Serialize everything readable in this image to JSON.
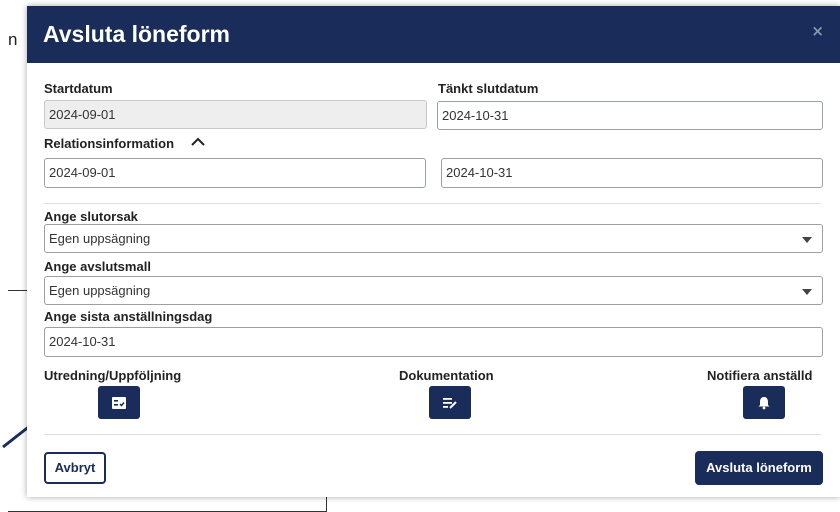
{
  "background": {
    "text_fragment": "n"
  },
  "modal": {
    "title": "Avsluta löneform",
    "close_symbol": "×",
    "start_date": {
      "label": "Startdatum",
      "value": "2024-09-01"
    },
    "planned_end_date": {
      "label": "Tänkt slutdatum",
      "value": "2024-10-31"
    },
    "relation_info": {
      "label": "Relationsinformation",
      "expanded": true,
      "start_value": "2024-09-01",
      "end_value": "2024-10-31"
    },
    "end_reason": {
      "label": "Ange slutorsak",
      "selected": "Egen uppsägning"
    },
    "end_template": {
      "label": "Ange avslutsmall",
      "selected": "Egen uppsägning"
    },
    "last_employment_day": {
      "label": "Ange sista anställningsdag",
      "value": "2024-10-31"
    },
    "actions": {
      "investigation": {
        "label": "Utredning/Uppföljning",
        "icon": "checklist-icon"
      },
      "documentation": {
        "label": "Dokumentation",
        "icon": "edit-note-icon"
      },
      "notify": {
        "label": "Notifiera anställd",
        "icon": "bell-icon"
      }
    },
    "cancel_label": "Avbryt",
    "submit_label": "Avsluta löneform"
  },
  "colors": {
    "header_bg": "#1a2d5a",
    "primary": "#1a2d5a",
    "disabled_field_bg": "#eeeeee"
  }
}
